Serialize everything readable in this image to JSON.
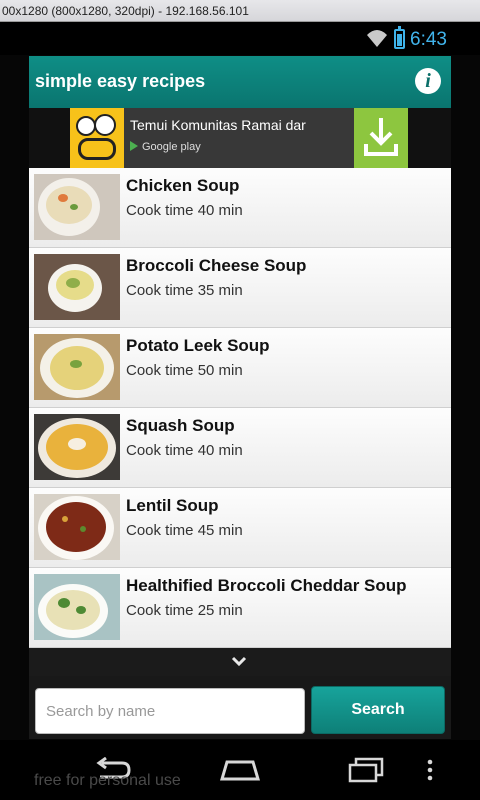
{
  "emulator": {
    "title": "00x1280 (800x1280, 320dpi) - 192.168.56.101"
  },
  "status": {
    "time": "6:43",
    "wifi_icon": "wifi-icon",
    "battery_icon": "battery-icon"
  },
  "appbar": {
    "title": "simple easy recipes",
    "info_icon": "info-icon",
    "info_label": "i"
  },
  "ad": {
    "text": "Temui Komunitas Ramai dar",
    "store_label": "Google play",
    "logo_icon": "beetalk-logo-icon",
    "download_icon": "download-icon",
    "colors": {
      "bg": "#383838",
      "logo": "#f7c21a",
      "download": "#8dc63f"
    }
  },
  "recipes": [
    {
      "name": "Chicken Soup",
      "time": "Cook time 40 min",
      "thumb": "chicken-soup-photo"
    },
    {
      "name": "Broccoli Cheese Soup",
      "time": "Cook time 35 min",
      "thumb": "broccoli-cheese-soup-photo"
    },
    {
      "name": "Potato Leek Soup",
      "time": "Cook time 50 min",
      "thumb": "potato-leek-soup-photo"
    },
    {
      "name": "Squash Soup",
      "time": "Cook time 40 min",
      "thumb": "squash-soup-photo"
    },
    {
      "name": "Lentil Soup",
      "time": "Cook time 45 min",
      "thumb": "lentil-soup-photo"
    },
    {
      "name": "Healthified Broccoli Cheddar Soup",
      "time": "Cook time 25 min",
      "thumb": "broccoli-cheddar-soup-photo"
    }
  ],
  "more": {
    "icon": "chevron-down-icon"
  },
  "search": {
    "placeholder": "Search by name",
    "value": "",
    "button_label": "Search"
  },
  "navbar": {
    "back_icon": "back-icon",
    "home_icon": "home-icon",
    "recents_icon": "recents-icon",
    "menu_icon": "overflow-menu-icon"
  },
  "watermark": "free for personal use",
  "colors": {
    "accent": "#0b7d76",
    "status_text": "#41b4ec"
  }
}
